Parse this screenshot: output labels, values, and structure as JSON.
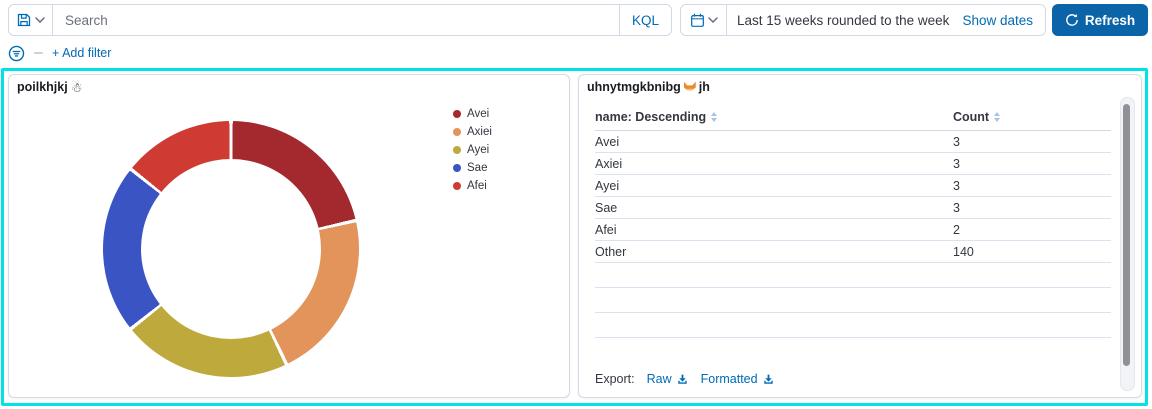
{
  "query_bar": {
    "search_placeholder": "Search",
    "kql_label": "KQL",
    "date_text": "Last 15 weeks rounded to the week",
    "show_dates_label": "Show dates",
    "refresh_label": "Refresh"
  },
  "filter_bar": {
    "add_filter_label": "+ Add filter"
  },
  "panels": {
    "pie": {
      "title": "poilkhjkj",
      "title_emoji": "☃",
      "emoji_icon": "snowman-emoji"
    },
    "table": {
      "title_prefix": "uhnytmgkbnibg",
      "emoji_icon": "fox-emoji",
      "title_suffix": "jh",
      "columns": [
        "name: Descending",
        "Count"
      ],
      "rows": [
        [
          "Avei",
          "3"
        ],
        [
          "Axiei",
          "3"
        ],
        [
          "Ayei",
          "3"
        ],
        [
          "Sae",
          "3"
        ],
        [
          "Afei",
          "2"
        ],
        [
          "Other",
          "140"
        ]
      ],
      "empty_row_count": 3,
      "export_label": "Export:",
      "export_links": [
        "Raw",
        "Formatted"
      ]
    }
  },
  "colors": {
    "accent_blue": "#006BB4",
    "refresh_button_bg": "#0B64A8",
    "selection_outline": "#00E3E6",
    "panel_border": "#D3DAE6",
    "text": "#343741",
    "muted_text": "#69707D",
    "row_divider": "#D9E2EF"
  },
  "chart_data": [
    {
      "type": "pie",
      "title": "poilkhjkj ☃",
      "labels": [
        "Avei",
        "Axiei",
        "Ayei",
        "Sae",
        "Afei"
      ],
      "values": [
        3,
        3,
        3,
        3,
        2
      ],
      "colors": [
        "#A4292F",
        "#E2945B",
        "#BEA93C",
        "#3A54C4",
        "#CF3A32"
      ],
      "donut": true,
      "inner_radius_ratio": 0.7,
      "start_angle_deg": 0,
      "direction": "clockwise",
      "legend_position": "right"
    },
    {
      "type": "table",
      "title": "uhnytmgkbnibg 🦊jh",
      "columns": [
        "name: Descending",
        "Count"
      ],
      "rows": [
        [
          "Avei",
          3
        ],
        [
          "Axiei",
          3
        ],
        [
          "Ayei",
          3
        ],
        [
          "Sae",
          3
        ],
        [
          "Afei",
          2
        ],
        [
          "Other",
          140
        ]
      ],
      "sort": {
        "column": "name",
        "order": "descending"
      }
    }
  ]
}
